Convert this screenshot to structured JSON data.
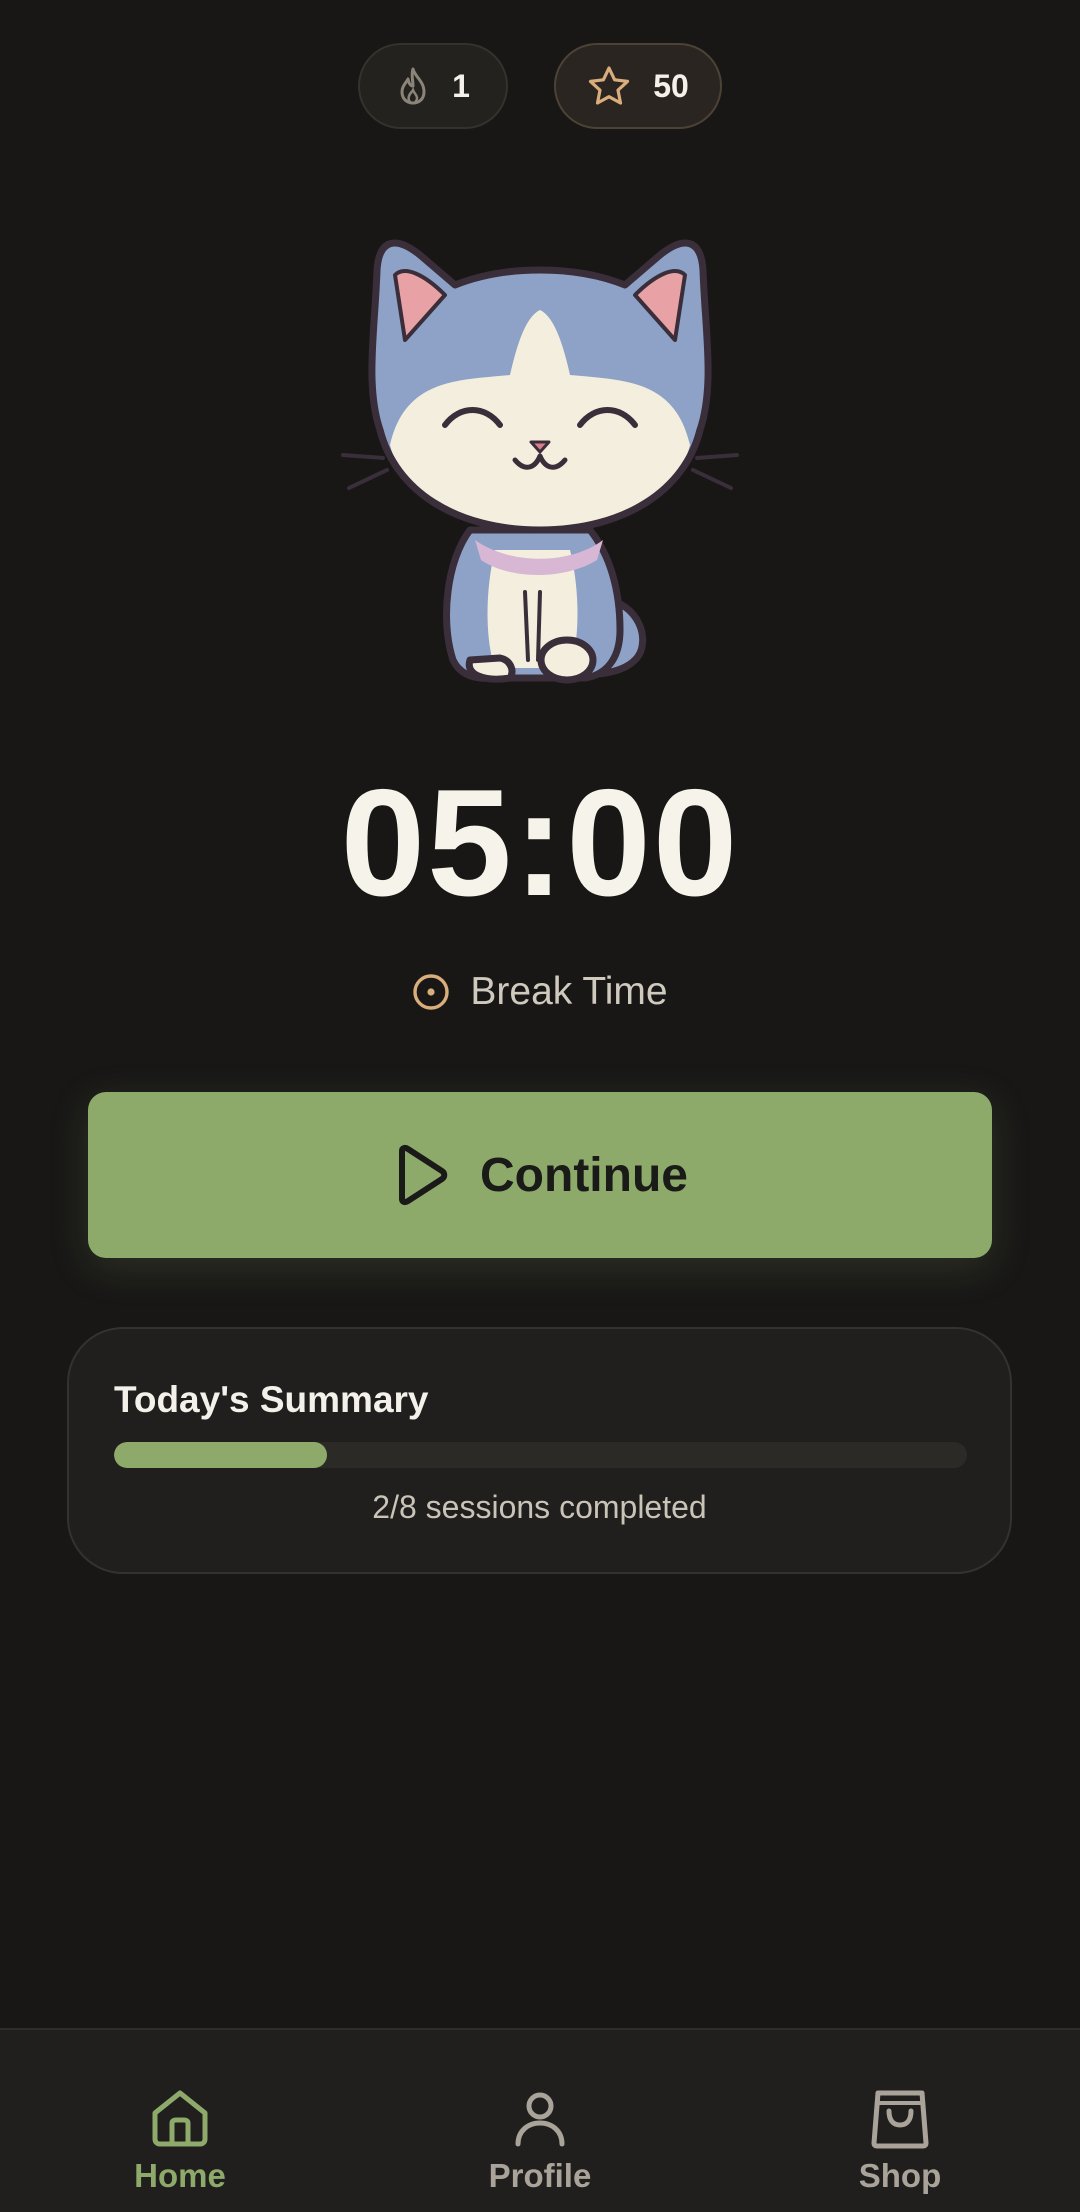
{
  "stats": {
    "streak_icon": "flame-icon",
    "streak_value": "1",
    "stars_icon": "star-icon",
    "stars_value": "50"
  },
  "mascot": {
    "icon": "cat-mascot"
  },
  "timer": {
    "display": "05:00"
  },
  "mode": {
    "icon": "target-dot-icon",
    "label": "Break Time"
  },
  "primary_action": {
    "icon": "play-icon",
    "label": "Continue"
  },
  "summary": {
    "title": "Today's Summary",
    "sessions_completed": 2,
    "sessions_total": 8,
    "progress_fraction": 0.25,
    "status_text": "2/8 sessions completed"
  },
  "nav": {
    "items": [
      {
        "label": "Home",
        "icon": "home-icon",
        "active": true
      },
      {
        "label": "Profile",
        "icon": "person-icon",
        "active": false
      },
      {
        "label": "Shop",
        "icon": "shopping-bag-icon",
        "active": false
      }
    ]
  },
  "colors": {
    "background": "#181716",
    "accent": "#8daa6b",
    "star": "#d9ad7c",
    "text": "#f2efe6"
  }
}
